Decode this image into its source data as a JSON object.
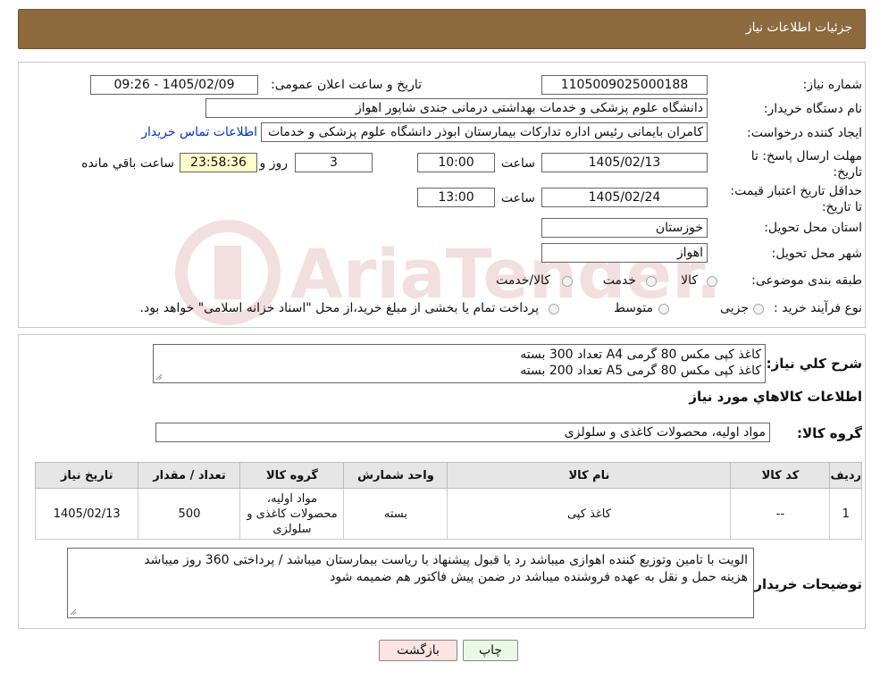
{
  "header": {
    "title": "جزئیات اطلاعات نیاز"
  },
  "fields": {
    "need_number_label": "شماره نیاز:",
    "need_number": "1105009025000188",
    "announce_label": "تاریخ و ساعت اعلان عمومی:",
    "announce_value": "1405/02/09 - 09:26",
    "buyer_org_label": "نام دستگاه خریدار:",
    "buyer_org": "دانشگاه علوم پزشکی و خدمات بهداشتی درمانی جندی شاپور اهواز",
    "creator_label": "ایجاد کننده درخواست:",
    "creator": "کامران بایمانی رئیس اداره تدارکات بیمارستان ابوذر  دانشگاه علوم پزشکی و خدمات",
    "contact_link": "اطلاعات تماس خریدار",
    "deadline_label": "مهلت ارسال پاسخ: تا تاریخ:",
    "deadline_date": "1405/02/13",
    "time_label": "ساعت",
    "deadline_time": "10:00",
    "days_value": "3",
    "days_label": "روز و",
    "remaining_time": "23:58:36",
    "remaining_label": "ساعت باقي مانده",
    "validity_label": "حداقل تاریخ اعتبار قیمت: تا تاریخ:",
    "validity_date": "1405/02/24",
    "validity_time": "13:00",
    "province_label": "استان محل تحویل:",
    "province": "خوزستان",
    "city_label": "شهر محل تحویل:",
    "city": "اهواز",
    "category_label": "طبقه بندی موضوعی:",
    "category_options": [
      "کالا",
      "خدمت",
      "کالا/خدمت"
    ],
    "process_label": "نوع فرآیند خرید :",
    "process_options": [
      "جزیی",
      "متوسط"
    ],
    "process_note": "پرداخت تمام یا بخشی از مبلغ خرید،از محل \"اسناد خزانه اسلامی\" خواهد بود."
  },
  "description": {
    "label": "شرح کلي نیاز:",
    "line1": "کاغذ کپی مکس 80 گرمی A4  تعداد 300 بسته",
    "line2": "کاغذ کپی مکس 80 گرمی A5  تعداد 200 بسته"
  },
  "goods": {
    "section_title": "اطلاعات کالاهاي مورد نیاز",
    "group_label": "گروه کالا:",
    "group_value": "مواد اولیه، محصولات کاغذی و سلولزی"
  },
  "table": {
    "headers": [
      "ردیف",
      "کد کالا",
      "نام کالا",
      "واحد شمارش",
      "گروه کالا",
      "تعداد / مقدار",
      "تاریخ نیاز"
    ],
    "row": {
      "index": "1",
      "code": "--",
      "name": "کاغذ کپی",
      "unit": "بسته",
      "group": "مواد اولیه، محصولات کاغذی و سلولزی",
      "qty": "500",
      "date": "1405/02/13"
    }
  },
  "buyer_notes": {
    "label": "توضیحات خریدار:",
    "line1": "الویت با تامین وتوزیع کننده اهوازی  میباشد رد یا قبول پیشنهاد با ریاست بیمارستان میباشد / پرداختی 360 روز میباشد",
    "line2": "هزینه حمل و نقل به عهده فروشنده میباشد  در ضمن پیش فاکتور هم ضمیمه شود"
  },
  "buttons": {
    "print": "چاپ",
    "back": "بازگشت"
  },
  "watermark": {
    "text": "AriaTender.neT",
    "color": "#a01010"
  },
  "colors": {
    "header": "#8c6a3e",
    "print_btn": "#eaf7e4",
    "back_btn": "#fde3e3",
    "link": "#0033cc"
  }
}
